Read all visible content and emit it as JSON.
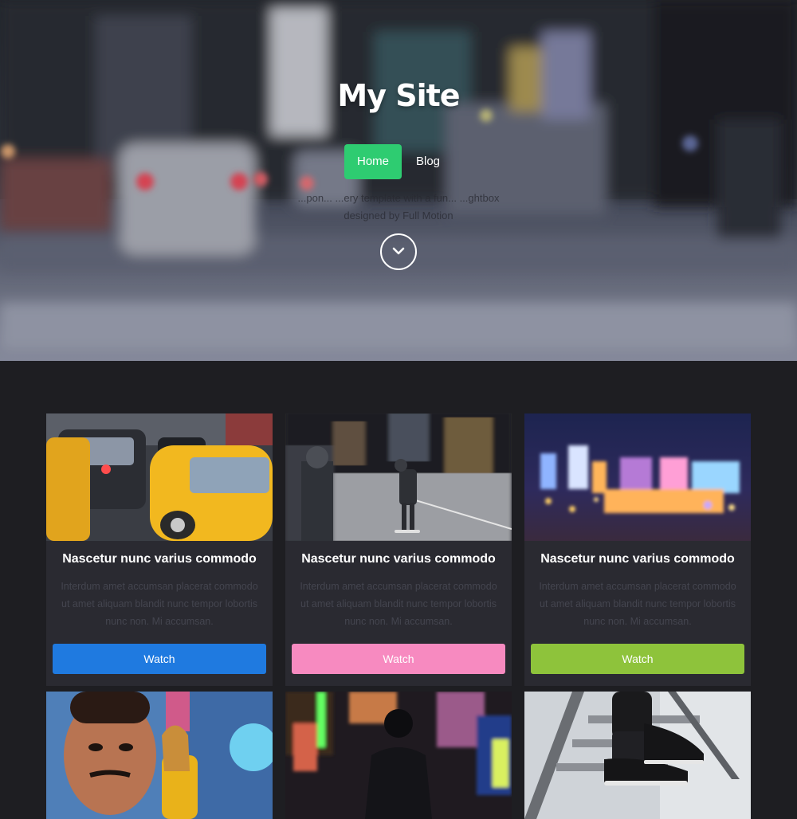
{
  "site": {
    "title": "My Site",
    "tagline_line1": "...pon... ...ery template with a fun... ...ghtbox",
    "tagline_line2": "designed by Full Motion"
  },
  "nav": {
    "items": [
      {
        "label": "Home",
        "active": true,
        "color": "#2ecc71"
      },
      {
        "label": "Blog",
        "active": false
      }
    ]
  },
  "icons": {
    "scroll_down": "chevron-down-icon"
  },
  "cards": [
    {
      "title": "Nascetur nunc varius commodo",
      "text": "Interdum amet accumsan placerat commodo ut amet aliquam blandit nunc tempor lobortis nunc non. Mi accumsan.",
      "button_label": "Watch",
      "button_color": "#1f7ae0",
      "image": "city-taxis"
    },
    {
      "title": "Nascetur nunc varius commodo",
      "text": "Interdum amet accumsan placerat commodo ut amet aliquam blandit nunc tempor lobortis nunc non. Mi accumsan.",
      "button_label": "Watch",
      "button_color": "#f78ac0",
      "image": "skateboarder-night"
    },
    {
      "title": "Nascetur nunc varius commodo",
      "text": "Interdum amet accumsan placerat commodo ut amet aliquam blandit nunc tempor lobortis nunc non. Mi accumsan.",
      "button_label": "Watch",
      "button_color": "#8ec33b",
      "image": "city-lights-bokeh"
    },
    {
      "title": "",
      "text": "",
      "button_label": "",
      "button_color": "#1f7ae0",
      "image": "graffiti-wall"
    },
    {
      "title": "",
      "text": "",
      "button_label": "",
      "button_color": "#f78ac0",
      "image": "neon-street"
    },
    {
      "title": "",
      "text": "",
      "button_label": "",
      "button_color": "#8ec33b",
      "image": "stairs-sneakers"
    }
  ]
}
